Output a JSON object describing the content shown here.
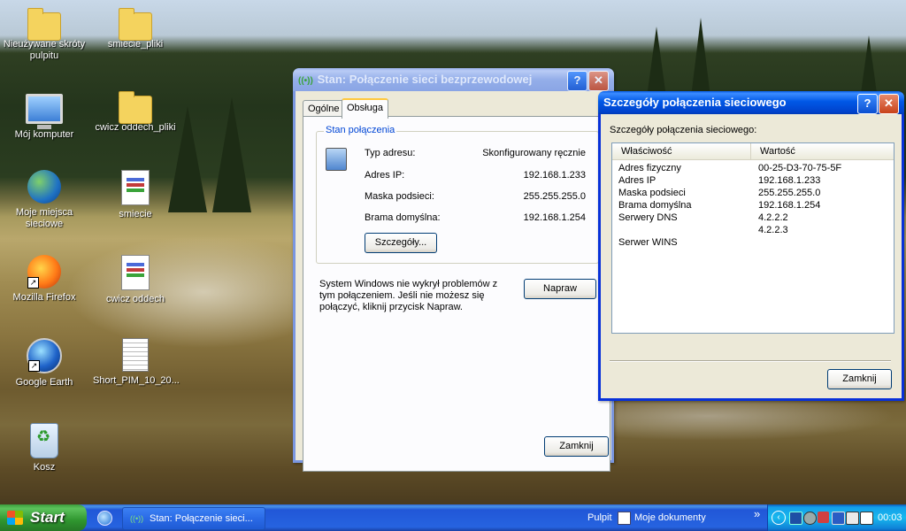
{
  "desktop": {
    "icons": [
      {
        "label": "Nieużywane skróty pulpitu",
        "icon": "folder-icon"
      },
      {
        "label": "smiecie_pliki",
        "icon": "folder-icon"
      },
      {
        "label": "Mój komputer",
        "icon": "my-computer-icon"
      },
      {
        "label": "cwicz oddech_pliki",
        "icon": "folder-icon"
      },
      {
        "label": "Moje miejsca sieciowe",
        "icon": "network-places-icon"
      },
      {
        "label": "smiecie",
        "icon": "html-document-icon"
      },
      {
        "label": "Mozilla Firefox",
        "icon": "firefox-icon"
      },
      {
        "label": "cwicz oddech",
        "icon": "html-document-icon"
      },
      {
        "label": "Google Earth",
        "icon": "google-earth-icon"
      },
      {
        "label": "Short_PIM_10_20...",
        "icon": "text-document-icon"
      },
      {
        "label": "Kosz",
        "icon": "recycle-bin-icon"
      }
    ]
  },
  "status_window": {
    "title": "Stan: Połączenie sieci bezprzewodowej",
    "help_btn": "?",
    "close_btn": "✕",
    "tabs": [
      "Ogólne",
      "Obsługa"
    ],
    "active_tab": "Obsługa",
    "group_title": "Stan połączenia",
    "rows": [
      {
        "label": "Typ adresu:",
        "value": "Skonfigurowany ręcznie"
      },
      {
        "label": "Adres IP:",
        "value": "192.168.1.233"
      },
      {
        "label": "Maska podsieci:",
        "value": "255.255.255.0"
      },
      {
        "label": "Brama domyślna:",
        "value": "192.168.1.254"
      }
    ],
    "details_button": "Szczegóły...",
    "repair_text": "System Windows nie wykrył problemów z tym połączeniem. Jeśli nie możesz się połączyć, kliknij przycisk Napraw.",
    "repair_button": "Napraw",
    "close_button": "Zamknij"
  },
  "details_window": {
    "title": "Szczegóły połączenia sieciowego",
    "help_btn": "?",
    "close_btn": "✕",
    "caption": "Szczegóły połączenia sieciowego:",
    "columns": [
      "Właściwość",
      "Wartość"
    ],
    "rows": [
      {
        "property": "Adres fizyczny",
        "value": "00-25-D3-70-75-5F"
      },
      {
        "property": "Adres IP",
        "value": "192.168.1.233"
      },
      {
        "property": "Maska podsieci",
        "value": "255.255.255.0"
      },
      {
        "property": "Brama domyślna",
        "value": "192.168.1.254"
      },
      {
        "property": "Serwery DNS",
        "value": "4.2.2.2"
      },
      {
        "property": "",
        "value": "4.2.2.3"
      },
      {
        "property": "Serwer WINS",
        "value": ""
      }
    ],
    "close_button": "Zamknij"
  },
  "taskbar": {
    "start_label": "Start",
    "task_item": "Stan: Połączenie sieci...",
    "toolbar_pulpit": "Pulpit",
    "toolbar_documents": "Moje dokumenty",
    "toolbar_chevron": "»",
    "clock": "00:03"
  }
}
